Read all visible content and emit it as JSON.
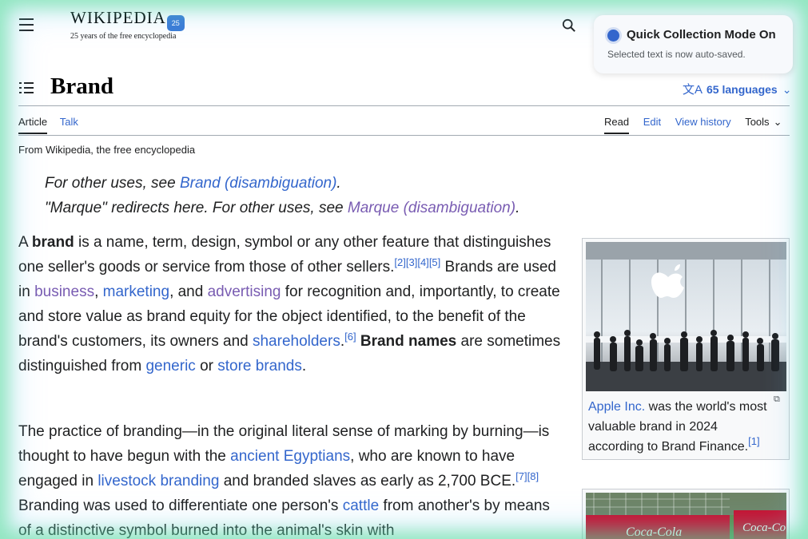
{
  "header": {
    "logo_word": "WIKIPEDIA",
    "logo_badge": "25",
    "logo_tagline": "25 years of the free encyclopedia"
  },
  "quick_collection": {
    "title": "Quick Collection Mode On",
    "subtitle": "Selected text is now auto-saved."
  },
  "page": {
    "title": "Brand",
    "languages": "65 languages",
    "tabs_left": [
      "Article",
      "Talk"
    ],
    "tabs_right": [
      "Read",
      "Edit",
      "View history",
      "Tools"
    ],
    "from_line": "From Wikipedia, the free encyclopedia"
  },
  "hatnotes": {
    "line1_pre": "For other uses, see ",
    "line1_link": "Brand (disambiguation)",
    "line1_post": ".",
    "line2_pre": "\"Marque\" redirects here. For other uses, see ",
    "line2_link": "Marque (disambiguation)",
    "line2_post": "."
  },
  "para1": {
    "t1": "A ",
    "b1": "brand",
    "t2": " is a name, term, design, symbol or any other feature that distinguishes one seller's goods or service from those of other sellers.",
    "ref1": "[2]",
    "ref2": "[3]",
    "ref3": "[4]",
    "ref4": "[5]",
    "t3": " Brands are used in ",
    "l1": "business",
    "t4": ", ",
    "l2": "marketing",
    "t5": ", and ",
    "l3": "advertising",
    "t6": " for recognition and, importantly, to create and store value as brand equity for the object identified, to the benefit of the brand's customers, its owners and ",
    "l4": "shareholders",
    "t7": ".",
    "ref5": "[6]",
    "t8": " ",
    "b2": "Brand names",
    "t9": " are sometimes distinguished from ",
    "l5": "generic",
    "t10": " or ",
    "l6": "store brands",
    "t11": "."
  },
  "para2": {
    "t1": "The practice of branding—in the original literal sense of marking by burning—is thought to have begun with the ",
    "l1": "ancient Egyptians",
    "t2": ", who are known to have engaged in ",
    "l2": "livestock branding",
    "t3": " and branded slaves as early as 2,700 BCE.",
    "ref1": "[7]",
    "ref2": "[8]",
    "t4": " Branding was used to differentiate one person's ",
    "l3": "cattle",
    "t5": " from another's by means of a distinctive symbol burned into the animal's skin with"
  },
  "infobox": {
    "caption_link": "Apple Inc.",
    "caption_text": " was the world's most valuable brand in 2024 according to Brand Finance.",
    "caption_ref": "[1]"
  },
  "infobox2": {
    "logo_text": "Coca-Cola"
  }
}
